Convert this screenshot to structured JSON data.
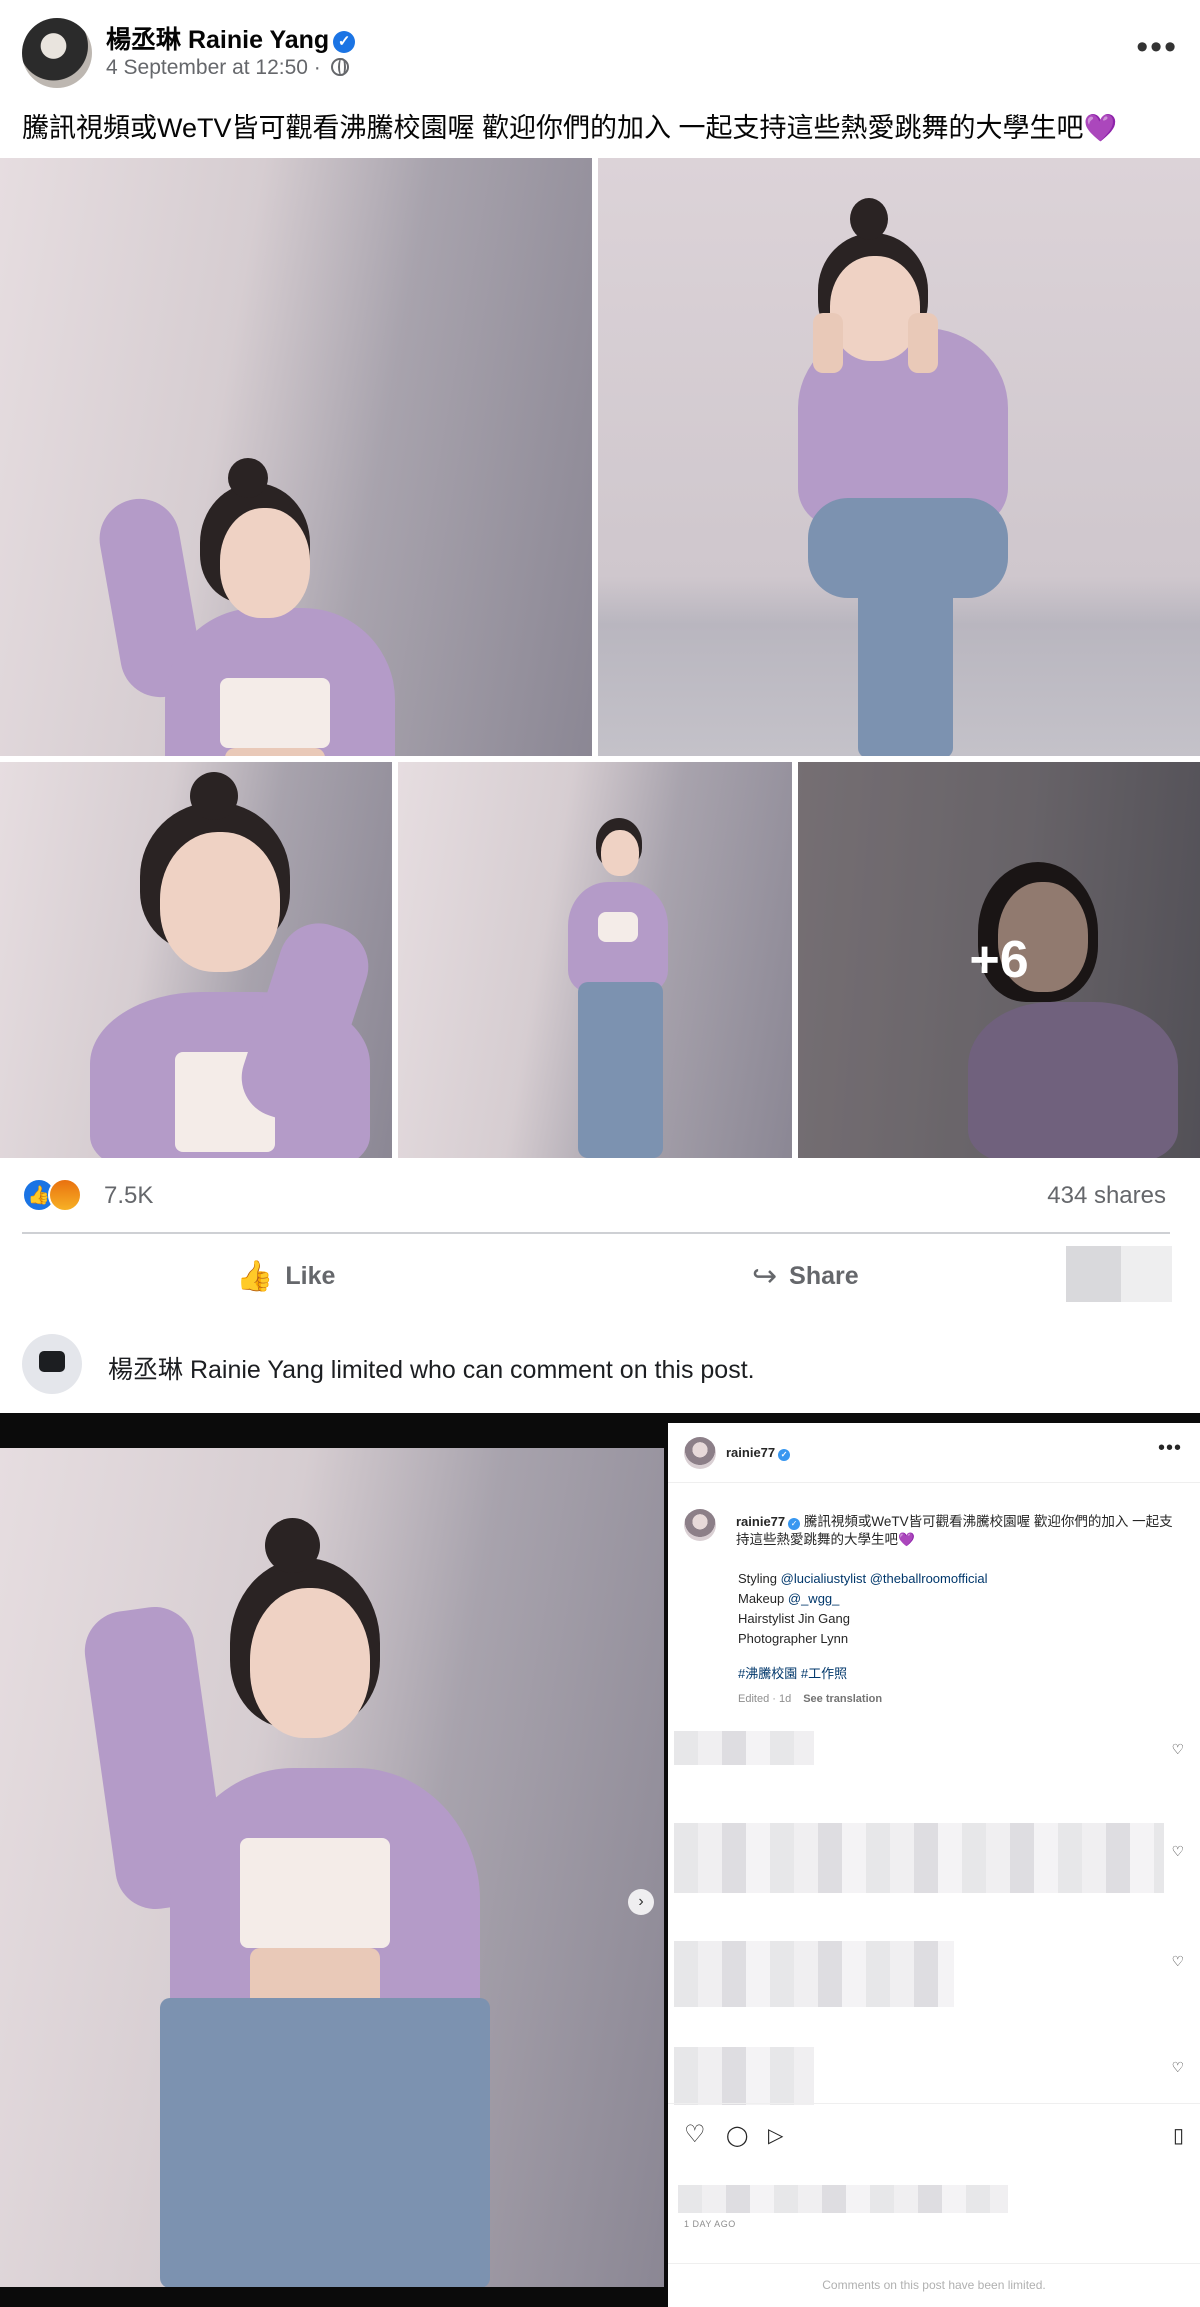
{
  "fb": {
    "author": "楊丞琳 Rainie Yang",
    "verified_glyph": "✓",
    "timestamp": "4 September at 12:50 ·",
    "more_glyph": "•••",
    "text": "騰訊視頻或WeTV皆可觀看沸騰校園喔 歡迎你們的加入 一起支持這些熱愛跳舞的大學生吧💜",
    "more_photos": "+6",
    "reaction_count": "7.5K",
    "shares": "434 shares",
    "like_label": "Like",
    "like_icon": "👍",
    "share_label": "Share",
    "share_icon": "↪",
    "comment_limit": "楊丞琳 Rainie Yang limited who can comment on this post."
  },
  "ig": {
    "username": "rainie77",
    "verified_glyph": "✓",
    "more_glyph": "•••",
    "next_glyph": "›",
    "caption_user": "rainie77",
    "caption": "騰訊視頻或WeTV皆可觀看沸騰校園喔 歡迎你們的加入 一起支持這些熱愛跳舞的大學生吧💜",
    "credits": {
      "styling_label": "Styling",
      "styling_tag1": "@lucialiustylist",
      "styling_tag2": "@theballroomofficial",
      "makeup_label": "Makeup",
      "makeup_tag": "@_wgg_",
      "hair": "Hairstylist Jin Gang",
      "photo": "Photographer Lynn"
    },
    "hashtags": "#沸騰校園 #工作照",
    "edited": "Edited · 1d",
    "see_translation": "See translation",
    "heart_glyph": "♡",
    "comment_glyph": "◯",
    "send_glyph": "▷",
    "save_glyph": "▯",
    "date": "1 DAY AGO",
    "comments_limited": "Comments on this post have been limited."
  },
  "colors": {
    "fb_blue": "#1b74e4",
    "ig_link": "#00376b",
    "cardigan_lilac": "#b49bc8"
  }
}
